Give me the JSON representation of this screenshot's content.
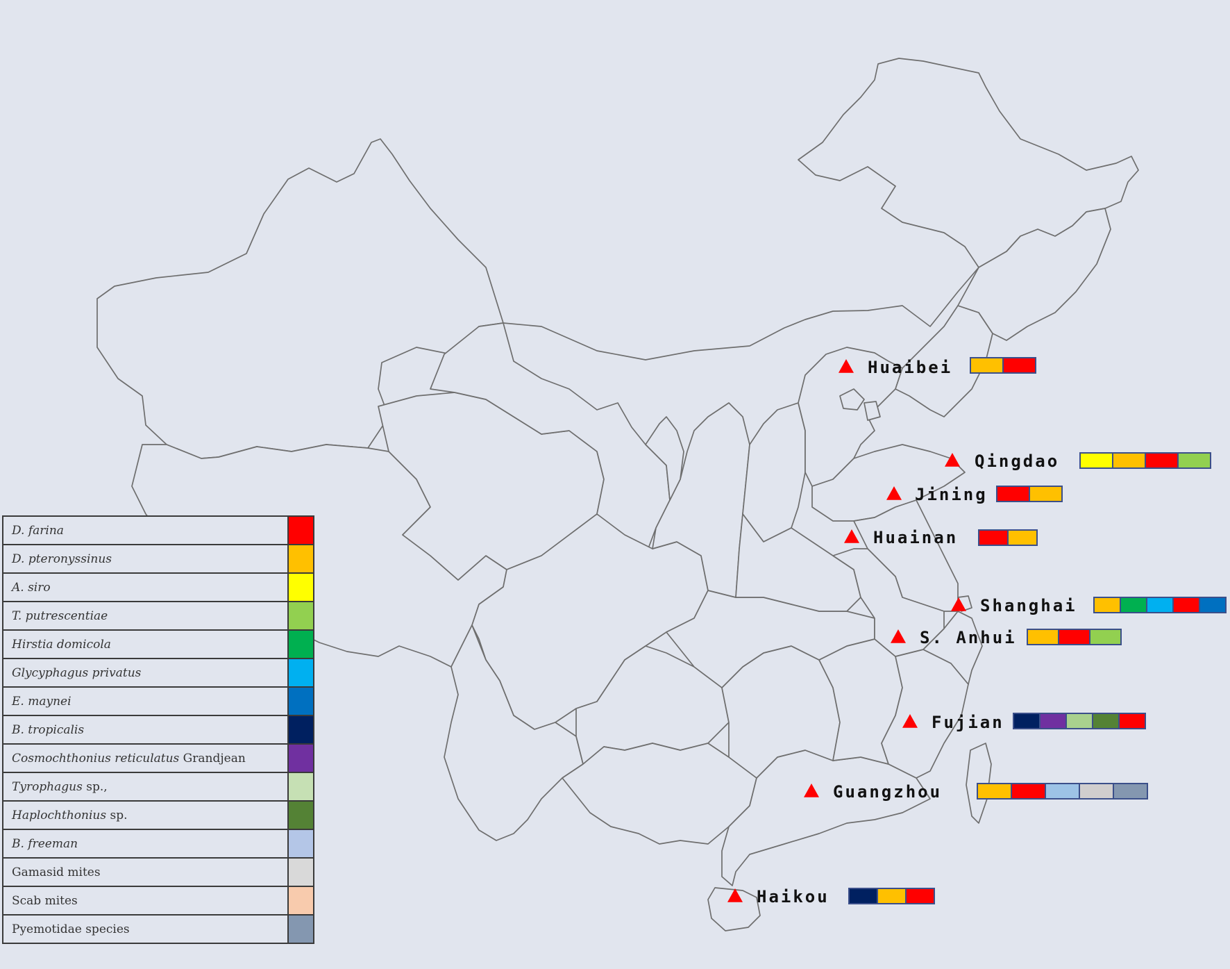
{
  "colors": {
    "background": "#e1e5ee",
    "province_stroke": "#6e6e6e",
    "marker": "#ff0000"
  },
  "legend": [
    {
      "italic": "D.  farina",
      "plain": "",
      "color": "#ff0000"
    },
    {
      "italic": "D.  pteronyssinus",
      "plain": "",
      "color": "#ffc000"
    },
    {
      "italic": "A.  siro",
      "plain": "",
      "color": "#ffff00"
    },
    {
      "italic": "T.  putrescentiae",
      "plain": "",
      "color": "#92d050"
    },
    {
      "italic": "Hirstia domicola",
      "plain": "",
      "color": "#00b050"
    },
    {
      "italic": "Glycyphagus privatus",
      "plain": "",
      "color": "#00b0f0"
    },
    {
      "italic": "E.  maynei",
      "plain": "",
      "color": "#0070c0"
    },
    {
      "italic": "B.  tropicalis",
      "plain": "",
      "color": "#002060"
    },
    {
      "italic": "Cosmochthonius reticulatus",
      "plain": " Grandjean",
      "color": "#7030a0"
    },
    {
      "italic": "Tyrophagus",
      "plain": " sp.,",
      "color": "#c6e0b4"
    },
    {
      "italic": "Haplochthonius",
      "plain": " sp.",
      "color": "#548235"
    },
    {
      "italic": "B.  freeman",
      "plain": "",
      "color": "#b4c6e7"
    },
    {
      "italic": "",
      "plain": "Gamasid mites",
      "color": "#d9d9d9"
    },
    {
      "italic": "",
      "plain": "Scab mites",
      "color": "#f8cbad"
    },
    {
      "italic": "",
      "plain": "Pyemotidae species",
      "color": "#8497b0"
    }
  ],
  "cities": [
    {
      "name": "Huaibei",
      "species": [
        "#ffc000",
        "#ff0000"
      ]
    },
    {
      "name": "Qingdao",
      "species": [
        "#ffff00",
        "#ffc000",
        "#ff0000",
        "#92d050"
      ]
    },
    {
      "name": "Jining",
      "species": [
        "#ff0000",
        "#ffc000"
      ]
    },
    {
      "name": "Huainan",
      "species": [
        "#ff0000",
        "#ffc000"
      ]
    },
    {
      "name": "Shanghai",
      "species": [
        "#ffc000",
        "#00b050",
        "#00b0f0",
        "#ff0000",
        "#0070c0"
      ]
    },
    {
      "name": "S. Anhui",
      "species": [
        "#ffc000",
        "#ff0000",
        "#92d050"
      ]
    },
    {
      "name": "Fujian",
      "species": [
        "#002060",
        "#7030a0",
        "#a9d18e",
        "#548235",
        "#ff0000"
      ]
    },
    {
      "name": "Guangzhou",
      "species": [
        "#ffc000",
        "#ff0000",
        "#9dc3e6",
        "#d0cece",
        "#8497b0"
      ]
    },
    {
      "name": "Haikou",
      "species": [
        "#002060",
        "#ffc000",
        "#ff0000"
      ]
    }
  ]
}
